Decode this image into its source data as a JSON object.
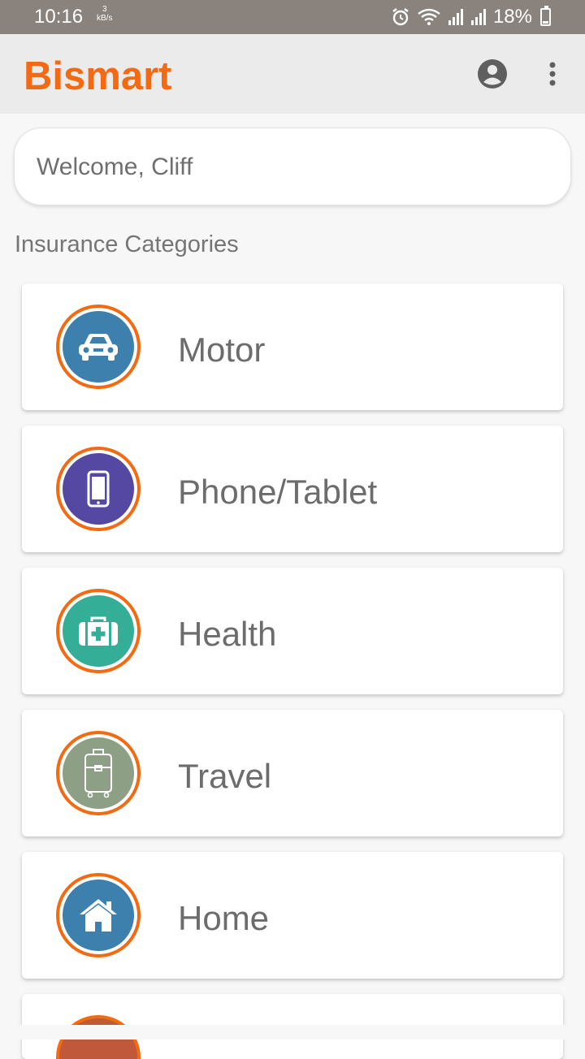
{
  "status_bar": {
    "time": "10:16",
    "net_speed_value": "3",
    "net_speed_unit": "kB/s",
    "battery": "18%"
  },
  "app_bar": {
    "title": "Bismart",
    "brand_color": "#f26a12"
  },
  "welcome": {
    "text": "Welcome, Cliff"
  },
  "section": {
    "title": "Insurance Categories"
  },
  "categories": [
    {
      "label": "Motor",
      "icon": "car-icon",
      "color": "#3d80ae"
    },
    {
      "label": "Phone/Tablet",
      "icon": "phone-icon",
      "color": "#5448a3"
    },
    {
      "label": "Health",
      "icon": "first-aid-kit-icon",
      "color": "#35ae98"
    },
    {
      "label": "Travel",
      "icon": "suitcase-icon",
      "color": "#8d9f84"
    },
    {
      "label": "Home",
      "icon": "home-icon",
      "color": "#3d80ae"
    }
  ]
}
